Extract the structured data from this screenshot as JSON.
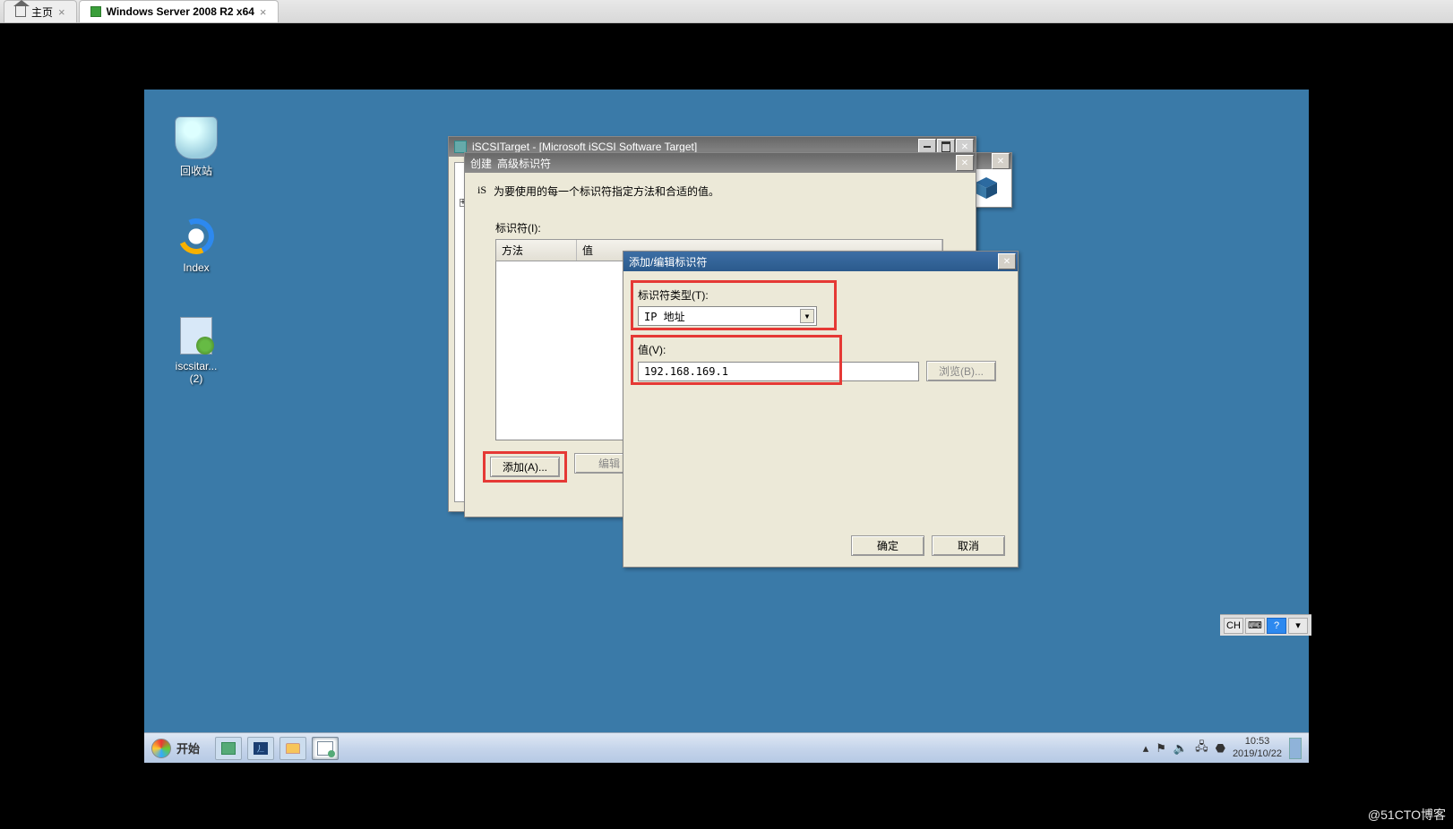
{
  "viewer": {
    "tabs": [
      {
        "label": "主页",
        "active": false
      },
      {
        "label": "Windows Server 2008 R2 x64",
        "active": true
      }
    ],
    "statusbar": {
      "lang": "CH"
    }
  },
  "desktop": {
    "icons": {
      "recycle": "回收站",
      "ie": "Index",
      "installer": "iscsitar...\n(2)"
    }
  },
  "win_iscsi": {
    "title": "iSCSITarget - [Microsoft iSCSI Software Target]"
  },
  "win_create": {
    "title_left": "创建",
    "title_right": "高级标识符",
    "desc": "为要使用的每一个标识符指定方法和合适的值。",
    "prefix": "iS",
    "id_label": "标识符(I):",
    "col_method": "方法",
    "col_value": "值",
    "btn_add": "添加(A)...",
    "btn_edit": "编辑"
  },
  "win_addid": {
    "title": "添加/编辑标识符",
    "type_label": "标识符类型(T):",
    "type_value": "IP 地址",
    "value_label": "值(V):",
    "value_input": "192.168.169.1",
    "btn_browse": "浏览(B)...",
    "btn_ok": "确定",
    "btn_cancel": "取消"
  },
  "taskbar": {
    "start": "开始",
    "tray_icons": [
      "⏏",
      "⚑",
      "🔈",
      "⚙",
      "🛡"
    ],
    "time": "10:53",
    "date": "2019/10/22"
  },
  "watermark": "@51CTO博客"
}
